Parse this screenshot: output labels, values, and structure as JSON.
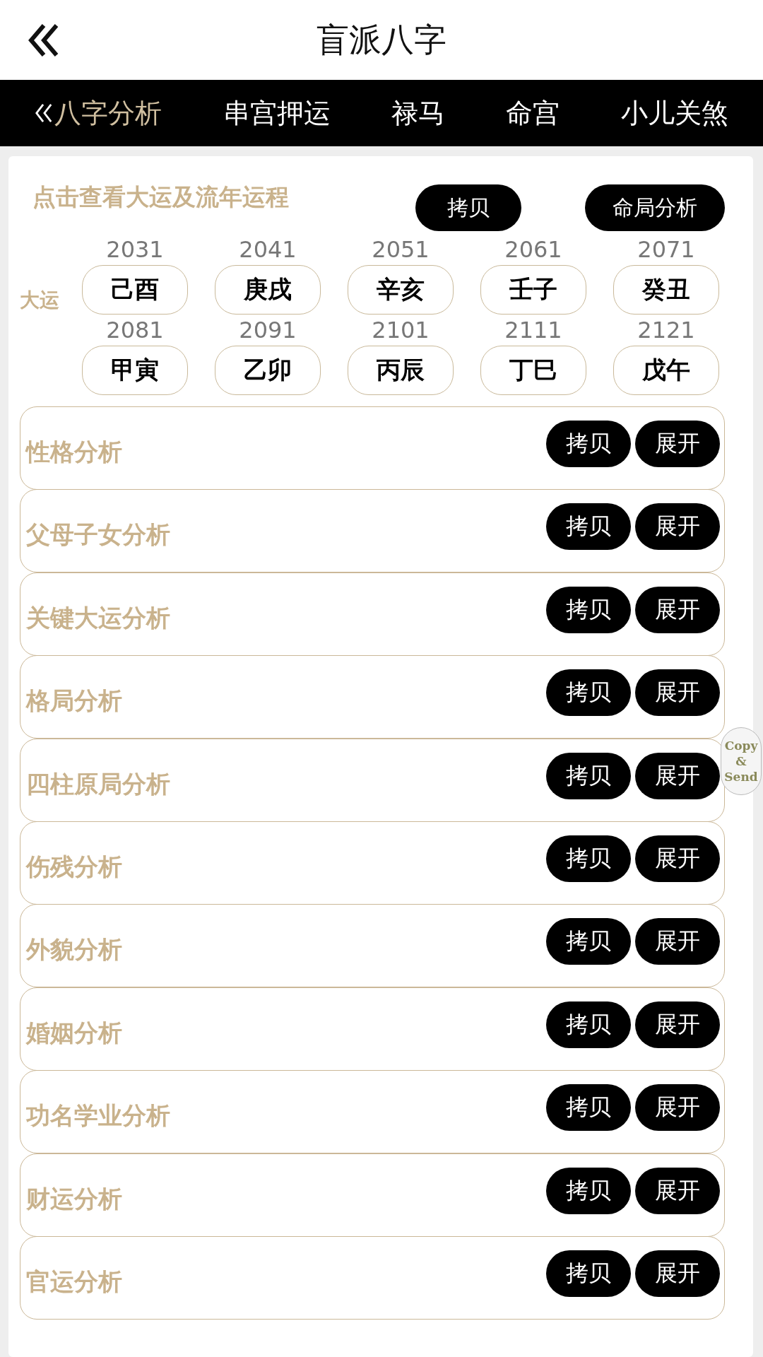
{
  "header": {
    "title": "盲派八字"
  },
  "tabs": [
    {
      "label": "八字分析",
      "selected": true
    },
    {
      "label": "串宫押运",
      "selected": false
    },
    {
      "label": "禄马",
      "selected": false
    },
    {
      "label": "命宫",
      "selected": false
    },
    {
      "label": "小儿关煞",
      "selected": false
    }
  ],
  "dayun": {
    "hint": "点击查看大运及流年运程",
    "copy_button": "拷贝",
    "analysis_button": "命局分析",
    "label": "大运",
    "periods": [
      {
        "year": "2031",
        "pillar": "己酉"
      },
      {
        "year": "2041",
        "pillar": "庚戌"
      },
      {
        "year": "2051",
        "pillar": "辛亥"
      },
      {
        "year": "2061",
        "pillar": "壬子"
      },
      {
        "year": "2071",
        "pillar": "癸丑"
      },
      {
        "year": "2081",
        "pillar": "甲寅"
      },
      {
        "year": "2091",
        "pillar": "乙卯"
      },
      {
        "year": "2101",
        "pillar": "丙辰"
      },
      {
        "year": "2111",
        "pillar": "丁巳"
      },
      {
        "year": "2121",
        "pillar": "戊午"
      }
    ]
  },
  "sections": [
    {
      "title": "性格分析",
      "copy": "拷贝",
      "expand": "展开"
    },
    {
      "title": "父母子女分析",
      "copy": "拷贝",
      "expand": "展开"
    },
    {
      "title": "关键大运分析",
      "copy": "拷贝",
      "expand": "展开"
    },
    {
      "title": "格局分析",
      "copy": "拷贝",
      "expand": "展开"
    },
    {
      "title": "四柱原局分析",
      "copy": "拷贝",
      "expand": "展开"
    },
    {
      "title": "伤残分析",
      "copy": "拷贝",
      "expand": "展开"
    },
    {
      "title": "外貌分析",
      "copy": "拷贝",
      "expand": "展开"
    },
    {
      "title": "婚姻分析",
      "copy": "拷贝",
      "expand": "展开"
    },
    {
      "title": "功名学业分析",
      "copy": "拷贝",
      "expand": "展开"
    },
    {
      "title": "财运分析",
      "copy": "拷贝",
      "expand": "展开"
    },
    {
      "title": "官运分析",
      "copy": "拷贝",
      "expand": "展开"
    }
  ],
  "floating_button": {
    "label": "Copy & Send"
  }
}
